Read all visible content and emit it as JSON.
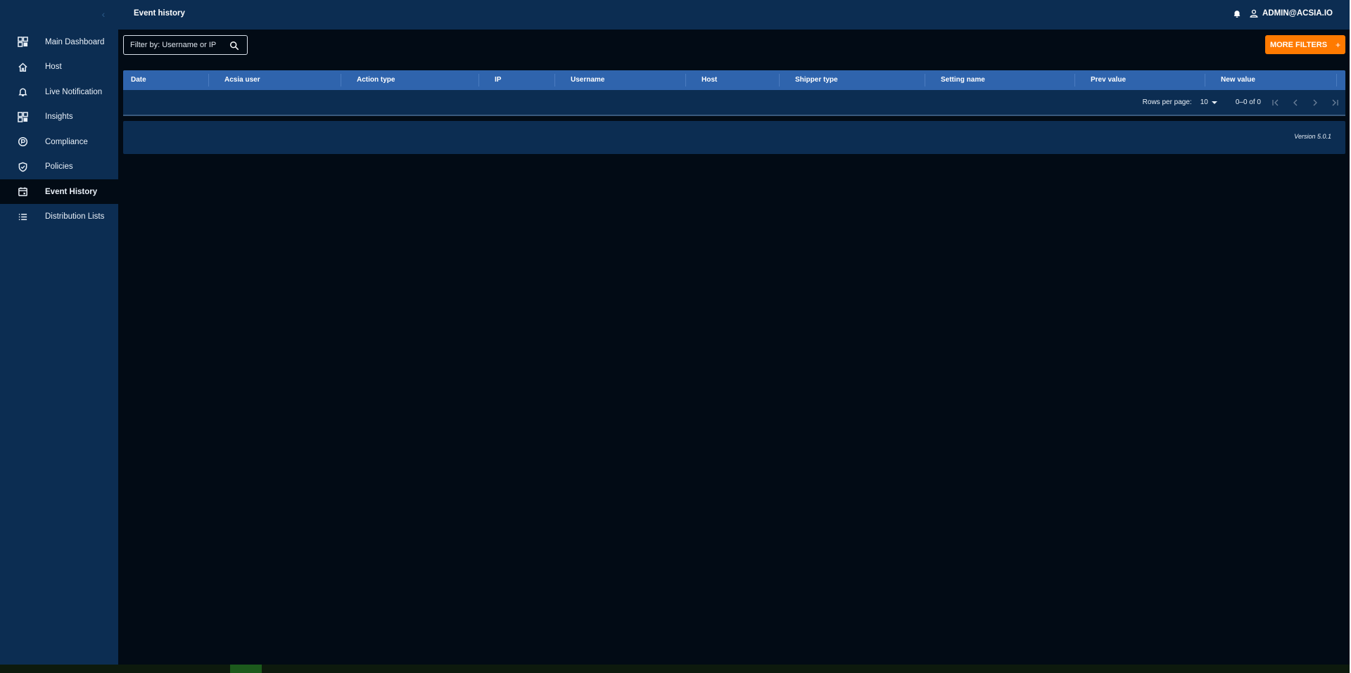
{
  "app": {
    "page_title": "Event history",
    "user_email": "ADMIN@ACSIA.IO"
  },
  "sidebar": {
    "items": [
      {
        "label": "Main Dashboard",
        "icon": "dashboard-icon",
        "active": false
      },
      {
        "label": "Host",
        "icon": "home-icon",
        "active": false
      },
      {
        "label": "Live Notification",
        "icon": "bell-icon",
        "active": false
      },
      {
        "label": "Insights",
        "icon": "dashboard-icon",
        "active": false
      },
      {
        "label": "Compliance",
        "icon": "compliance-icon",
        "active": false
      },
      {
        "label": "Policies",
        "icon": "shield-icon",
        "active": false
      },
      {
        "label": "Event History",
        "icon": "calendar-icon",
        "active": true
      },
      {
        "label": "Distribution Lists",
        "icon": "list-icon",
        "active": false
      }
    ]
  },
  "filter": {
    "placeholder": "Filter by: Username or IP",
    "value": ""
  },
  "more_filters": {
    "label": "MORE FILTERS",
    "icon": "+"
  },
  "table": {
    "columns": [
      "Date",
      "Acsia user",
      "Action type",
      "IP",
      "Username",
      "Host",
      "Shipper type",
      "Setting name",
      "Prev value",
      "New value"
    ],
    "rows": []
  },
  "pagination": {
    "rows_per_page_label": "Rows per page:",
    "rows_per_page": "10",
    "range": "0–0 of 0"
  },
  "footer": {
    "version": "Version 5.0.1"
  },
  "colors": {
    "background": "#020b15",
    "panel": "#0c2d52",
    "table_header": "#2f64ad",
    "accent": "#ff7a00"
  }
}
